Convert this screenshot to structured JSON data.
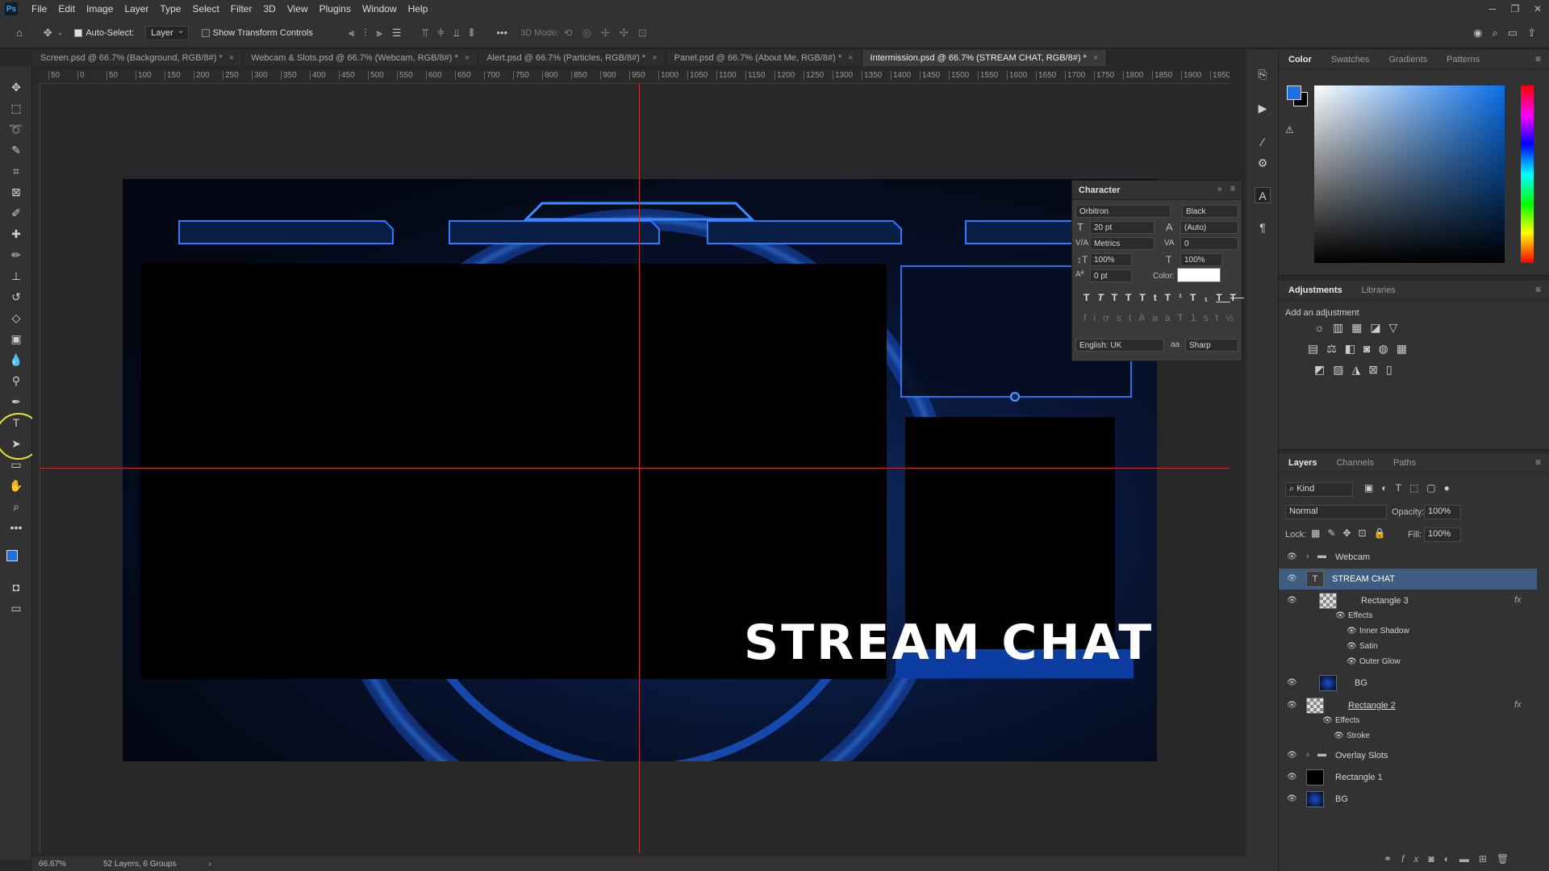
{
  "app": {
    "logo": "Ps"
  },
  "menu": [
    "File",
    "Edit",
    "Image",
    "Layer",
    "Type",
    "Select",
    "Filter",
    "3D",
    "View",
    "Plugins",
    "Window",
    "Help"
  ],
  "options": {
    "auto_select_label": "Auto-Select:",
    "auto_select_value": "Layer",
    "show_transform_label": "Show Transform Controls",
    "mode_3d_label": "3D Mode:"
  },
  "tabs": [
    {
      "label": "Screen.psd @ 66.7% (Background, RGB/8#) *"
    },
    {
      "label": "Webcam & Slots.psd @ 66.7% (Webcam, RGB/8#) *"
    },
    {
      "label": "Alert.psd @ 66.7% (Particles, RGB/8#) *"
    },
    {
      "label": "Panel.psd @ 66.7% (About Me, RGB/8#) *"
    },
    {
      "label": "Intermission.psd @ 66.7% (STREAM CHAT, RGB/8#) *"
    }
  ],
  "ruler_h": [
    "50",
    "0",
    "50",
    "100",
    "150",
    "200",
    "250",
    "300",
    "350",
    "400",
    "450",
    "500",
    "550",
    "600",
    "650",
    "700",
    "750",
    "800",
    "850",
    "900",
    "950",
    "1000",
    "1050",
    "1100",
    "1150",
    "1200",
    "1250",
    "1300",
    "1350",
    "1400",
    "1450",
    "1500",
    "1550",
    "1600",
    "1650",
    "1700",
    "1750",
    "1800",
    "1850",
    "1900",
    "1950"
  ],
  "canvas": {
    "headline": "STREAM CHAT"
  },
  "character": {
    "title": "Character",
    "font_family": "Orbitron",
    "font_style": "Black",
    "size": "20 pt",
    "leading": "(Auto)",
    "kerning": "Metrics",
    "tracking": "0",
    "vscale": "100%",
    "hscale": "100%",
    "baseline": "0 pt",
    "color_label": "Color:",
    "language": "English: UK",
    "antialias": "Sharp",
    "aa_label": "aa"
  },
  "color_panel": {
    "tabs": [
      "Color",
      "Swatches",
      "Gradients",
      "Patterns"
    ]
  },
  "adjustments": {
    "tabs": [
      "Adjustments",
      "Libraries"
    ],
    "hint": "Add an adjustment"
  },
  "layers_panel": {
    "tabs": [
      "Layers",
      "Channels",
      "Paths"
    ],
    "kind_label": "Kind",
    "blend_mode": "Normal",
    "opacity_label": "Opacity:",
    "opacity": "100%",
    "lock_label": "Lock:",
    "fill_label": "Fill:",
    "fill": "100%",
    "layers": [
      {
        "name": "Webcam"
      },
      {
        "name": "STREAM CHAT"
      },
      {
        "name": "Rectangle 3"
      },
      {
        "name": "Effects"
      },
      {
        "name": "Inner Shadow"
      },
      {
        "name": "Satin"
      },
      {
        "name": "Outer Glow"
      },
      {
        "name": "BG"
      },
      {
        "name": "Rectangle 2"
      },
      {
        "name": "Effects"
      },
      {
        "name": "Stroke"
      },
      {
        "name": "Overlay Slots"
      },
      {
        "name": "Rectangle 1"
      },
      {
        "name": "BG"
      }
    ]
  },
  "status": {
    "zoom": "66.67%",
    "info": "52 Layers, 6 Groups"
  }
}
